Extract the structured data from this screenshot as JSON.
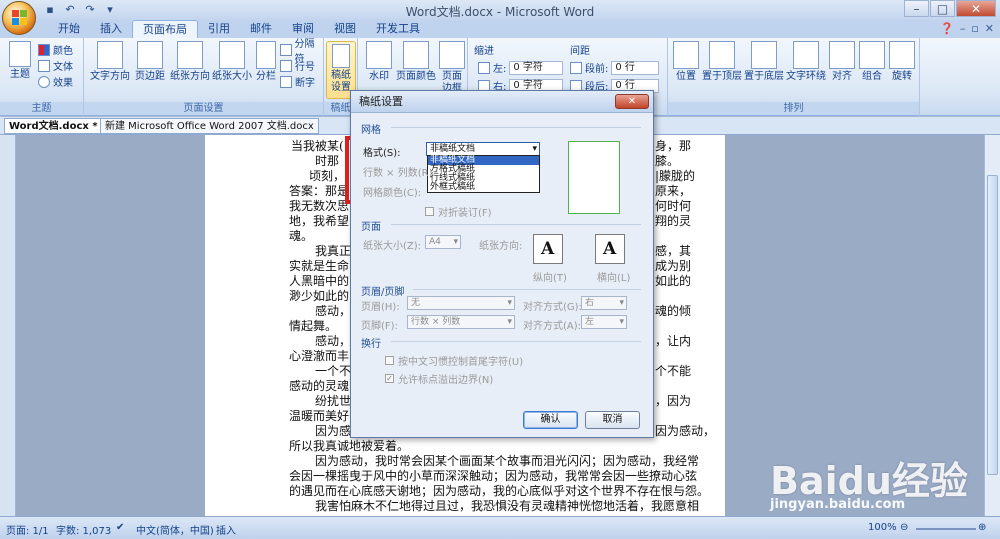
{
  "window": {
    "title": "Word文档.docx - Microsoft Word",
    "controls": [
      "–",
      "□",
      "✕"
    ]
  },
  "ribbon_tabs": [
    "开始",
    "插入",
    "页面布局",
    "引用",
    "邮件",
    "审阅",
    "视图",
    "开发工具"
  ],
  "active_tab": "页面布局",
  "ribbon": {
    "themes": {
      "big_label": "主题",
      "colors": "颜色",
      "fonts": "文体",
      "effects": "效果",
      "group": "主题"
    },
    "page_setup": {
      "text_direction": "文字方向",
      "margins": "页边距",
      "orientation": "纸张方向",
      "size": "纸张大小",
      "columns": "分栏",
      "breaks": "分隔符",
      "line_numbers": "行号",
      "hyphenation": "断字",
      "group": "页面设置"
    },
    "manuscript": {
      "label_1": "稿纸",
      "label_2": "设置",
      "group": "稿纸"
    },
    "page_background": {
      "watermark": "水印",
      "page_color": "页面颜色",
      "page_border_1": "页面",
      "page_border_2": "边框"
    },
    "paragraph": {
      "indent": "缩进",
      "indent_left_label": "左:",
      "indent_left_value": "0 字符",
      "indent_right_label": "右:",
      "indent_right_value": "0 字符",
      "spacing": "间距",
      "spacing_before_label": "段前:",
      "spacing_before_value": "0 行",
      "spacing_after_label": "段后:",
      "spacing_after_value": "0 行"
    },
    "arrange": {
      "position": "位置",
      "bring_front": "置于顶层",
      "send_back": "置于底层",
      "text_wrap": "文字环绕",
      "align": "对齐",
      "group_btn": "组合",
      "rotate": "旋转",
      "group": "排列"
    }
  },
  "doc_tabs": [
    "Word文档.docx *",
    "新建 Microsoft Office Word 2007 文档.docx"
  ],
  "document_lines": [
    "当我被某(",
    "时那",
    "顷刻，",
    "答案：那是",
    "我无数次思",
    "地，我希望",
    "魂。",
    "我真正",
    "实就是生命",
    "人黑暗中的",
    "渺少如此的",
    "感动，",
    "情起舞。",
    "感动，",
    "心澄澈而丰",
    "一个不",
    "感动的灵魂",
    "纷扰世",
    "温暖而美好",
    "因为感",
    "所以我真诚地被爱着。",
    "因为感动，我时常会因某个画面某个故事而泪光闪闪；因为感动，我经常",
    "会因一棵摇曳于风中的小草而深深触动；因为感动，我常常会因一些撩动心弦",
    "的遇见而在心底感天谢地；因为感动，我的心底似乎对这个世界不存在恨与怨。",
    "我害怕麻木不仁地得过且过，我恐惧没有灵魂精神恍惚地活着，我愿意相"
  ],
  "document_right_fragments": [
    "身，那",
    "膝。",
    "|朦胧的",
    "原来，",
    "何时何",
    "翔的灵",
    "感，其",
    "成为别",
    "如此的",
    "魂的倾",
    "，让内",
    "个不能",
    "，因为",
    "因为感动，"
  ],
  "dialog": {
    "title": "稿纸设置",
    "close": "✕",
    "grid_section": "网格",
    "style_label": "格式(S):",
    "style_value": "非稿纸文档",
    "style_options": [
      "非稿纸文档",
      "方格式稿纸",
      "行线式稿纸",
      "外框式稿纸"
    ],
    "rows_cols_label": "行数 × 列数(R):",
    "grid_color_label": "网格颜色(C):",
    "align_row": "对折装订(F)",
    "page_section": "页面",
    "paper_size_label": "纸张大小(Z):",
    "paper_size_value": "A4",
    "orientation_label": "纸张方向:",
    "portrait": "纵向(T)",
    "landscape": "横向(L)",
    "header_footer_section": "页眉/页脚",
    "header_label": "页眉(H):",
    "header_value": "无",
    "header_align_label": "对齐方式(G):",
    "header_align_value": "右",
    "footer_label": "页脚(F):",
    "footer_value": "行数 × 列数",
    "footer_align_label": "对齐方式(A):",
    "footer_align_value": "左",
    "wrap_section": "换行",
    "wrap_opt1": "按中文习惯控制首尾字符(U)",
    "wrap_opt2": "允许标点溢出边界(N)",
    "ok": "确认",
    "cancel": "取消"
  },
  "statusbar": {
    "page": "页面: 1/1",
    "words": "字数: 1,073",
    "language": "中文(简体，中国)",
    "mode": "插入",
    "zoom": "100%"
  },
  "watermark": {
    "brand": "Baidu经验",
    "url": "jingyan.baidu.com"
  },
  "colors": {
    "highlight_red": "#e0201b",
    "arrow_magenta": "#e028c8",
    "ribbon_text": "#15428b"
  }
}
